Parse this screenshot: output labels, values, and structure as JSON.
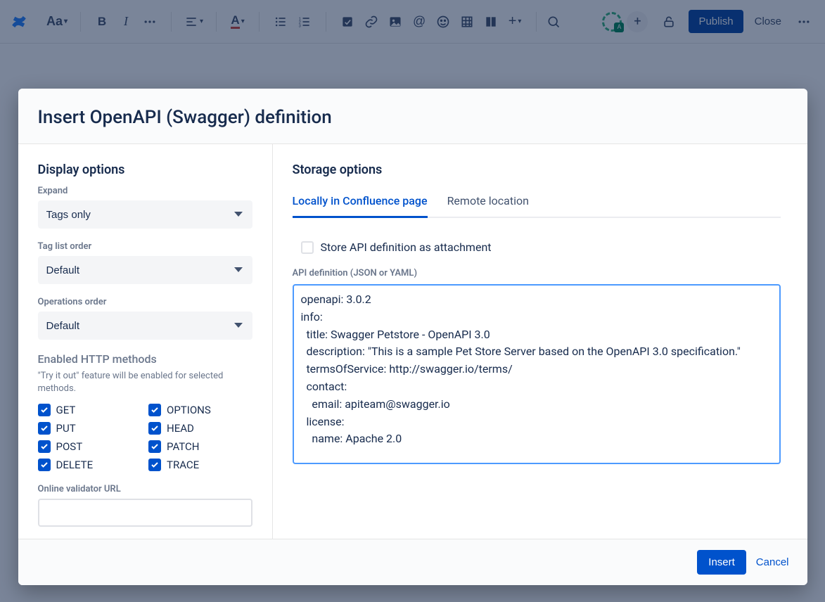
{
  "toolbar": {
    "text_styles_label": "Aa",
    "publish": "Publish",
    "close": "Close"
  },
  "modal": {
    "title": "Insert OpenAPI (Swagger) definition",
    "left": {
      "section": "Display options",
      "expand_label": "Expand",
      "expand_value": "Tags only",
      "taglist_label": "Tag list order",
      "taglist_value": "Default",
      "opsorder_label": "Operations order",
      "opsorder_value": "Default",
      "methods_heading": "Enabled HTTP methods",
      "methods_help": "\"Try it out\" feature will be enabled for selected methods.",
      "methods": {
        "get": "GET",
        "put": "PUT",
        "post": "POST",
        "delete": "DELETE",
        "options": "OPTIONS",
        "head": "HEAD",
        "patch": "PATCH",
        "trace": "TRACE"
      },
      "validator_label": "Online validator URL",
      "validator_value": ""
    },
    "right": {
      "section": "Storage options",
      "tab_local": "Locally in Confluence page",
      "tab_remote": "Remote location",
      "store_attachment": "Store API definition as attachment",
      "api_label": "API definition (JSON or YAML)",
      "api_value": "openapi: 3.0.2\ninfo:\n  title: Swagger Petstore - OpenAPI 3.0\n  description: \"This is a sample Pet Store Server based on the OpenAPI 3.0 specification.\"\n  termsOfService: http://swagger.io/terms/\n  contact:\n    email: apiteam@swagger.io\n  license:\n    name: Apache 2.0"
    },
    "footer": {
      "insert": "Insert",
      "cancel": "Cancel"
    }
  }
}
